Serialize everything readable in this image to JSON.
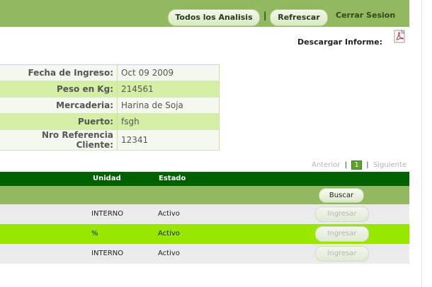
{
  "topbar": {
    "all_analysis": "Todos los Analisis",
    "separator": "|",
    "refresh": "Refrescar",
    "logout": "Cerrar Sesion"
  },
  "download": {
    "label": "Descargar Informe:",
    "icon": "pdf-icon"
  },
  "info": [
    {
      "label": "Fecha de Ingreso:",
      "value": "Oct 09 2009"
    },
    {
      "label": "Peso en Kg:",
      "value": "214561"
    },
    {
      "label": "Mercaderia:",
      "value": "Harina de Soja"
    },
    {
      "label": "Puerto:",
      "value": "fsgh"
    },
    {
      "label": "Nro Referencia Cliente:",
      "value": "12341"
    }
  ],
  "pager": {
    "prev": "Anterior",
    "sep": "|",
    "current": "1",
    "next": "Siguiente"
  },
  "grid": {
    "headers": {
      "unidad": "Unidad",
      "estado": "Estado"
    },
    "search_button": "Buscar",
    "rows": [
      {
        "unidad": "INTERNO",
        "estado": "Activo",
        "action": "Ingresar"
      },
      {
        "unidad": "%",
        "estado": "Activo",
        "action": "Ingresar"
      },
      {
        "unidad": "INTERNO",
        "estado": "Activo",
        "action": "Ingresar"
      }
    ]
  },
  "colors": {
    "topbar": "#92b960",
    "grid_header": "#006100",
    "highlight_row": "#99e600"
  }
}
